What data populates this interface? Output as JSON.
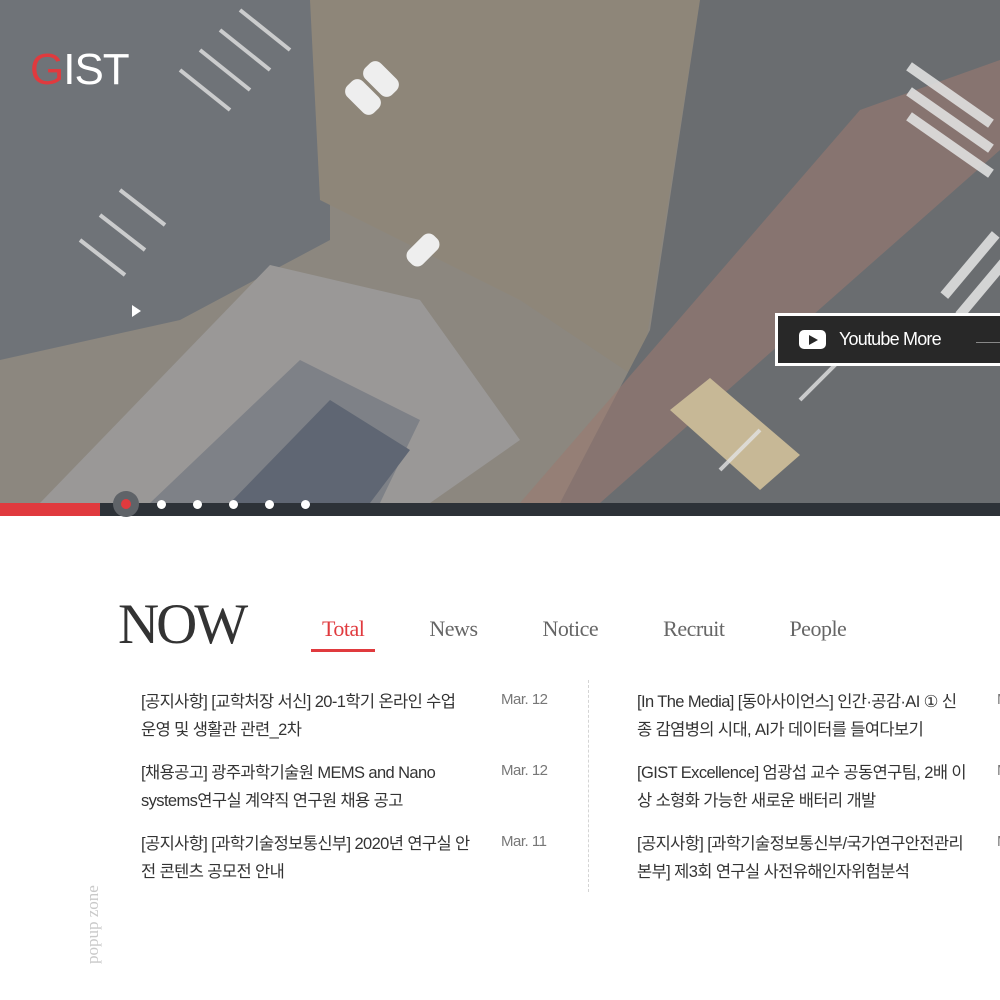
{
  "header": {
    "logo_first": "G",
    "logo_rest": "IST"
  },
  "hero": {
    "youtube_label": "Youtube More",
    "slide_count": 6,
    "active_slide": 1,
    "progress": 0.1
  },
  "now": {
    "title": "NOW",
    "tabs": [
      "Total",
      "News",
      "Notice",
      "Recruit",
      "People"
    ],
    "active_tab": "Total",
    "left_items": [
      {
        "title": "[공지사항] [교학처장 서신] 20-1학기 온라인 수업 운영 및 생활관 관련_2차",
        "date": "Mar. 12"
      },
      {
        "title": "[채용공고] 광주과학기술원 MEMS and Nano systems연구실 계약직 연구원 채용 공고",
        "date": "Mar. 12"
      },
      {
        "title": "[공지사항] [과학기술정보통신부] 2020년 연구실 안전 콘텐츠 공모전 안내",
        "date": "Mar. 11"
      }
    ],
    "right_items": [
      {
        "title": "[In The Media] [동아사이언스] 인간·공감·AI ① 신종 감염병의 시대, AI가 데이터를 들여다보기",
        "date": "M"
      },
      {
        "title": "[GIST Excellence] 엄광섭 교수 공동연구팀, 2배 이상 소형화 가능한 새로운 배터리 개발",
        "date": "M"
      },
      {
        "title": "[공지사항] [과학기술정보통신부/국가연구안전관리본부] 제3회 연구실 사전유해인자위험분석",
        "date": "M"
      }
    ]
  },
  "popup_zone_label": "popup zone",
  "colors": {
    "accent": "#e03a3e",
    "dark": "#2d3238",
    "text": "#333333"
  }
}
